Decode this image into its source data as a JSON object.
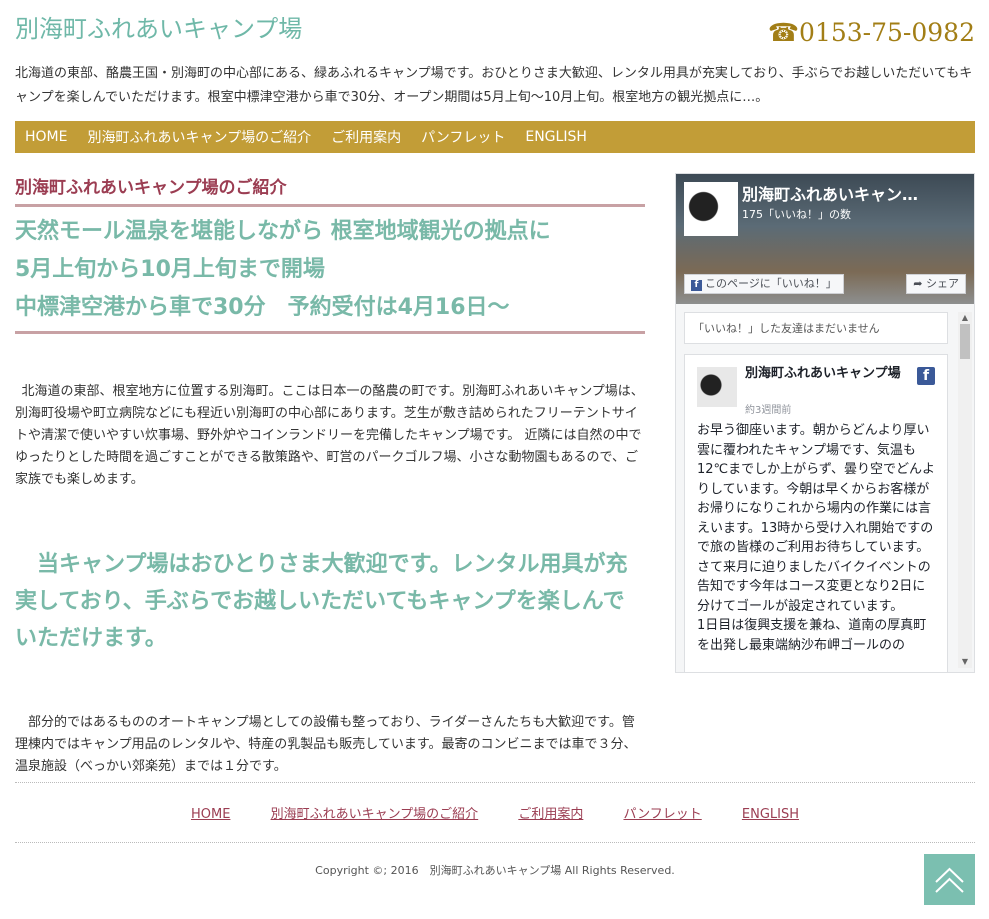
{
  "header": {
    "site_title": "別海町ふれあいキャンプ場",
    "phone": "☎0153-75-0982",
    "intro": "北海道の東部、酪農王国・別海町の中心部にある、緑あふれるキャンプ場です。おひとりさま大歓迎、レンタル用具が充実しており、手ぶらでお越しいただいてもキャンプを楽しんでいただけます。根室中標津空港から車で30分、オープン期間は5月上旬〜10月上旬。根室地方の観光拠点に…。"
  },
  "nav": [
    "HOME",
    "別海町ふれあいキャンプ場のご紹介",
    "ご利用案内",
    "パンフレット",
    "ENGLISH"
  ],
  "main": {
    "section_title": "別海町ふれあいキャンプ場のご紹介",
    "catch": [
      "天然モール温泉を堪能しながら 根室地域観光の拠点に",
      "5月上旬から10月上旬まで開場",
      "中標津空港から車で30分　予約受付は4月16日〜"
    ],
    "paragraph1": "北海道の東部、根室地方に位置する別海町。ここは日本一の酪農の町です。別海町ふれあいキャンプ場は、別海町役場や町立病院などにも程近い別海町の中心部にあります。芝生が敷き詰められたフリーテントサイトや清潔で使いやすい炊事場、野外炉やコインランドリーを完備したキャンプ場です。 近隣には自然の中でゆったりとした時間を過ごすことができる散策路や、町営のパークゴルフ場、小さな動物園もあるので、ご家族でも楽しめます。",
    "highlight": "当キャンプ場はおひとりさま大歓迎です。レンタル用具が充実しており、手ぶらでお越しいただいてもキャンプを楽しんでいただけます。",
    "paragraph2": "部分的ではあるもののオートキャンプ場としての設備も整っており、ライダーさんたちも大歓迎です。管理棟内ではキャンプ用品のレンタルや、特産の乳製品も販売しています。最寄のコンビニまでは車で３分、 温泉施設（べっかい郊楽苑）までは１分です。"
  },
  "facebook": {
    "page_name": "別海町ふれあいキャン…",
    "likes": "175「いいね！」の数",
    "like_button": "このページに「いいね！」",
    "share_button": "シェア",
    "friends_text": "「いいね！」した友達はまだいません",
    "post_author": "別海町ふれあいキャンプ場",
    "post_time": "約3週間前",
    "post_text": "お早う御座います。朝からどんより厚い雲に覆われたキャンプ場です、気温も12℃までしか上がらず、曇り空でどんよりしています。今朝は早くからお客様がお帰りになりこれから場内の作業には言えいます。13時から受け入れ開始ですので旅の皆様のご利用お待ちしています。さて来月に迫りましたバイクイベントの告知です今年はコース変更となり2日に分けてゴールが設定されています。\n1日目は復興支援を兼ね、道南の厚真町を出発し最東端納沙布岬ゴールのの"
  },
  "footer": {
    "nav": [
      "HOME",
      "別海町ふれあいキャンプ場のご紹介",
      "ご利用案内",
      "パンフレット",
      "ENGLISH"
    ],
    "copyright": "Copyright ©; 2016　別海町ふれあいキャンプ場 All Rights Reserved."
  },
  "colors": {
    "nav_bg": "#c29d37",
    "accent_green": "#79b9a8",
    "accent_red": "#9b3d52",
    "phone": "#a27e16"
  }
}
